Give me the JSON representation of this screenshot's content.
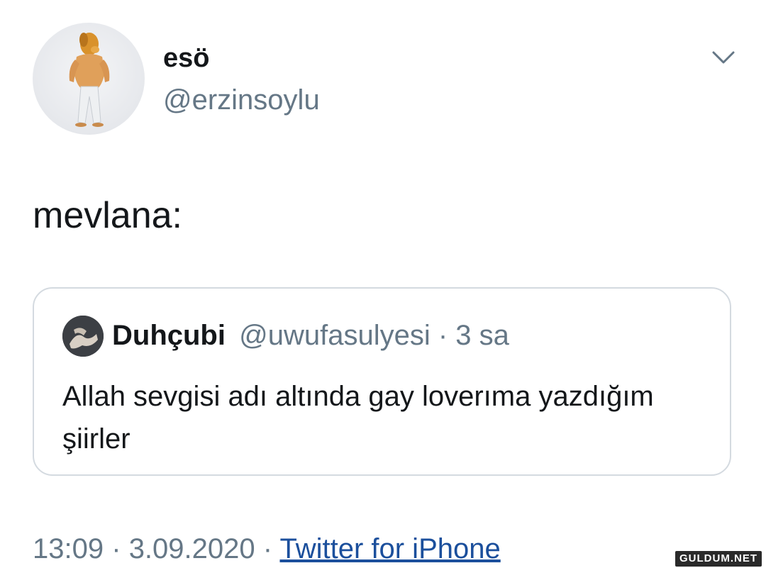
{
  "author": {
    "display_name": "esö",
    "handle": "@erzinsoylu",
    "avatar_icon": "muscular-dog-figure-avatar"
  },
  "menu_icon": "chevron-down-icon",
  "tweet": {
    "text": "mevlana:"
  },
  "quoted_tweet": {
    "display_name": "Duhçubi",
    "handle": "@uwufasulyesi",
    "separator": "·",
    "time": "3 sa",
    "avatar_icon": "hands-avatar",
    "text": "Allah sevgisi adı altında gay loverıma yazdığım şiirler"
  },
  "meta": {
    "time": "13:09",
    "separator": "·",
    "date": "3.09.2020",
    "source": "Twitter for iPhone"
  },
  "watermark": "GULDUM.NET",
  "colors": {
    "text_primary": "#14171a",
    "text_secondary": "#657786",
    "link": "#1b4f9c",
    "card_border": "#d4dae0"
  }
}
